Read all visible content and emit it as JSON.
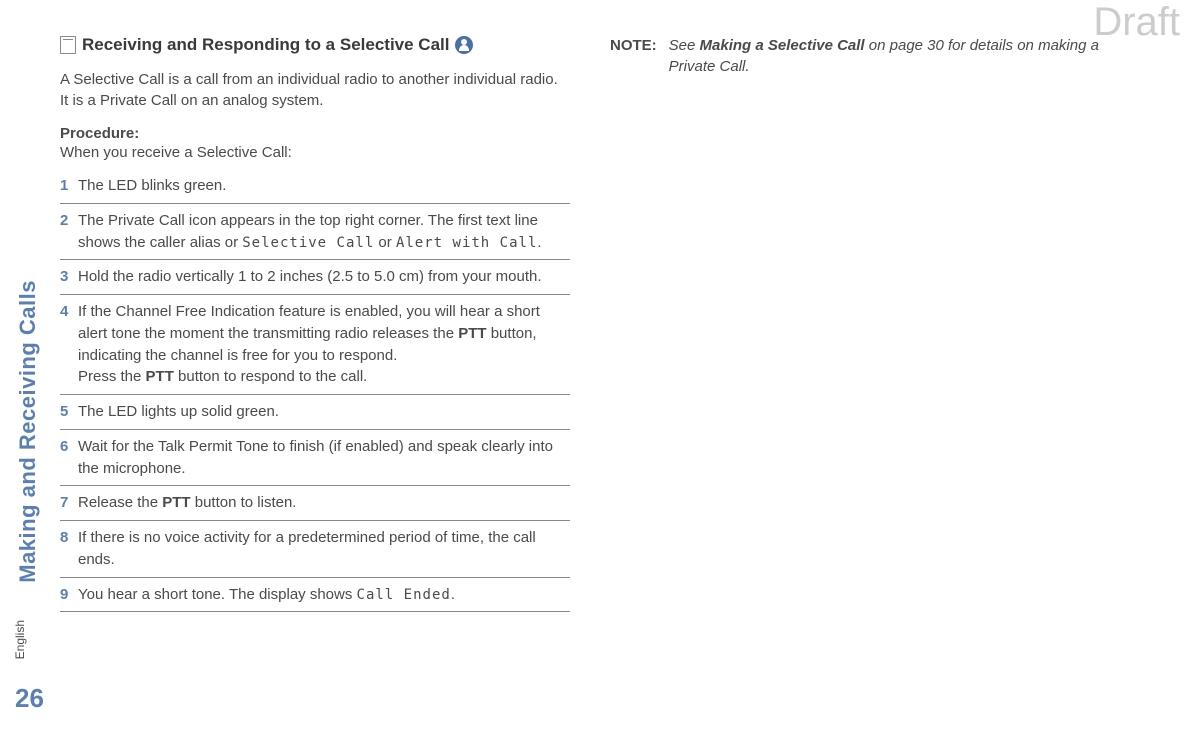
{
  "watermark": "Draft",
  "sidebar_title": "Making and Receiving Calls",
  "page_number": "26",
  "language_label": "English",
  "heading": "Receiving and Responding to a Selective Call",
  "intro": "A Selective Call is a call from an individual radio to another individual radio. It is a Private Call on an analog system.",
  "procedure_label": "Procedure:",
  "procedure_sub": "When you receive a Selective Call:",
  "lcd": {
    "selective_call": "Selective Call",
    "alert_with_call": "Alert with Call",
    "call_ended": "Call Ended"
  },
  "bold": {
    "ptt": "PTT",
    "or": "OR"
  },
  "steps": [
    {
      "num": "1",
      "text": "The LED blinks green."
    },
    {
      "num": "2",
      "pre": "The Private Call icon appears in the top right corner. The first text line shows the caller alias or ",
      "mid_or": " or ",
      "end": "."
    },
    {
      "num": "3",
      "text": "Hold the radio vertically 1 to 2 inches (2.5 to 5.0 cm) from your mouth."
    },
    {
      "num": "4",
      "pre": "If the Channel Free Indication feature is enabled, you will hear a short alert tone the moment the transmitting radio releases the ",
      "mid1": " button, indicating the channel is free for you to respond.",
      "line2_pre": "Press the ",
      "line2_post": " button to respond to the call."
    },
    {
      "num": "5",
      "text": "The LED lights up solid green."
    },
    {
      "num": "6",
      "text": "Wait for the Talk Permit Tone to finish (if enabled) and speak clearly into the microphone."
    },
    {
      "num": "7",
      "pre": "Release the ",
      "post": " button to listen."
    },
    {
      "num": "8",
      "text": "If there is no voice activity for a predetermined period of time, the call ends."
    },
    {
      "num": "9",
      "pre": "You hear a short tone. The display shows ",
      "post": "."
    }
  ],
  "note": {
    "label": "NOTE:",
    "pre": "See ",
    "bold_italic": "Making a Selective Call",
    "post": " on page 30 for details on making a Private Call."
  }
}
